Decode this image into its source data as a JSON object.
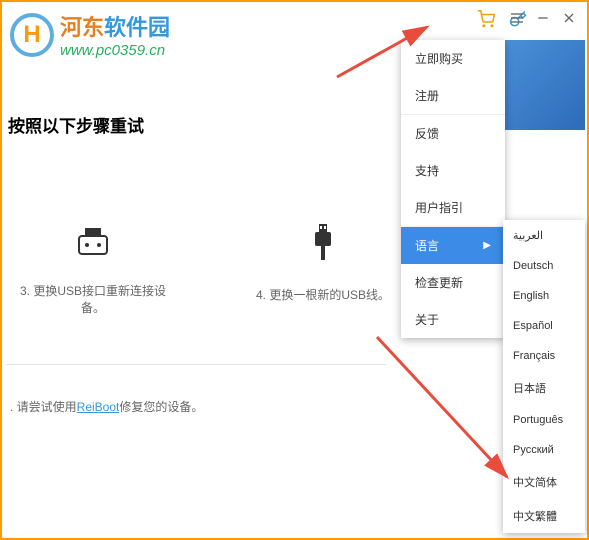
{
  "watermark": {
    "title1": "河东",
    "title2": "软件园",
    "url": "www.pc0359.cn"
  },
  "instruction": "按照以下步骤重试",
  "steps": [
    {
      "text": "3. 更换USB接口重新连接设备。"
    },
    {
      "text": "4. 更换一根新的USB线。"
    }
  ],
  "hint_prefix": ". 请尝试使用",
  "hint_link": "ReiBoot",
  "hint_suffix": "修复您的设备。",
  "menu": {
    "items": [
      "立即购买",
      "注册",
      "反馈",
      "支持",
      "用户指引",
      "语言",
      "检查更新",
      "关于"
    ]
  },
  "languages": [
    "العربية",
    "Deutsch",
    "English",
    "Español",
    "Français",
    "日本語",
    "Português",
    "Русский",
    "中文简体",
    "中文繁體"
  ]
}
